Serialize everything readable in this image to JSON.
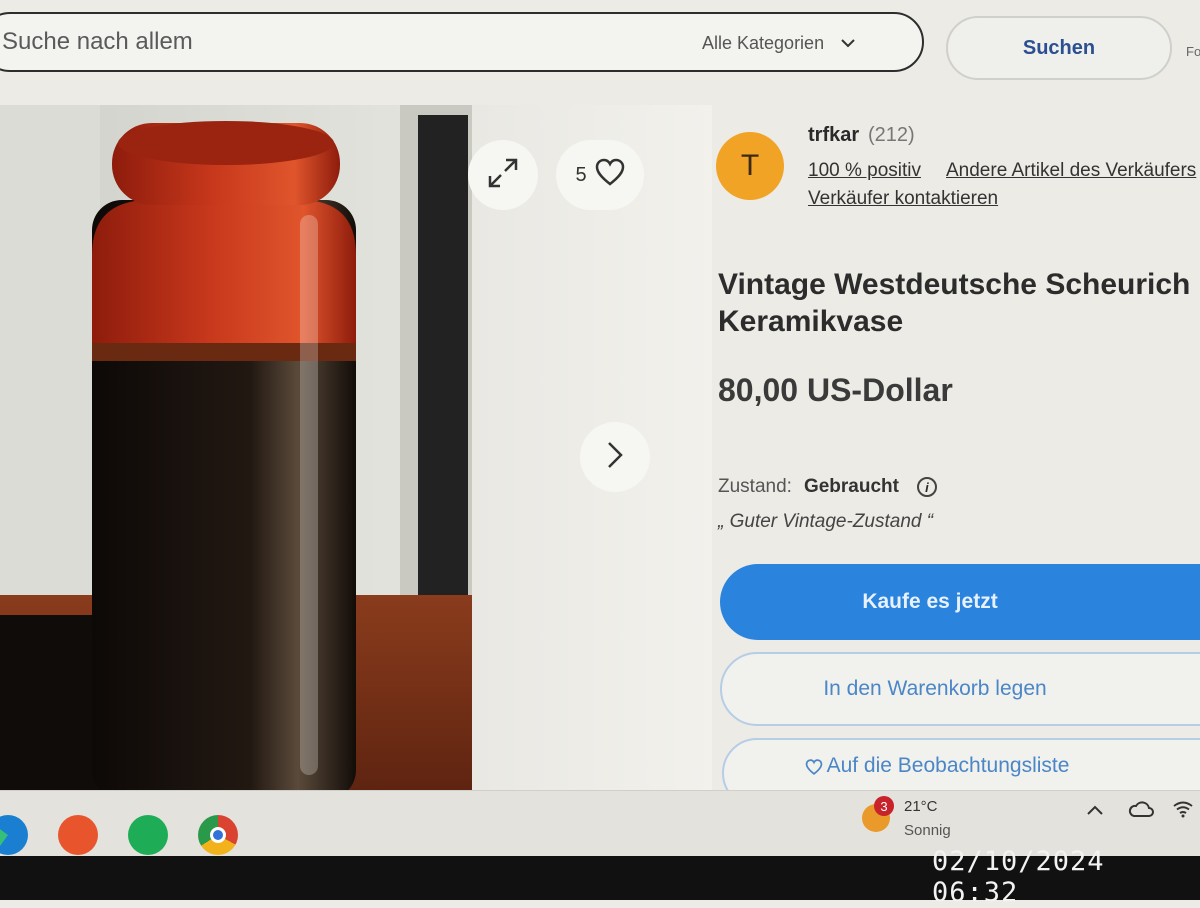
{
  "header": {
    "search_placeholder": "Suche nach allem",
    "category_label": "Alle Kategorien",
    "search_button": "Suchen",
    "advanced_label": "Fo"
  },
  "gallery": {
    "watch_count": "5"
  },
  "seller": {
    "avatar_letter": "T",
    "name": "trfkar",
    "rating_count": "(212)",
    "feedback": "100 % positiv",
    "other_items": "Andere Artikel des Verkäufers",
    "contact": "Verkäufer kontaktieren"
  },
  "item": {
    "title_line1": "Vintage Westdeutsche Scheurich",
    "title_line2": "Keramikvase",
    "price": "80,00 US-Dollar",
    "condition_label": "Zustand:",
    "condition_value": "Gebraucht",
    "condition_note": "„ Guter Vintage-Zustand “"
  },
  "actions": {
    "buy_now": "Kaufe es jetzt",
    "add_to_cart": "In den Warenkorb legen",
    "watchlist": "Auf die Beobachtungsliste"
  },
  "taskbar": {
    "weather_badge": "3",
    "temperature": "21°C",
    "weather": "Sonnig"
  },
  "photo_timestamp": "02/10/2024  06:32",
  "colors": {
    "accent": "#2a83dd",
    "seller_avatar": "#f1a326",
    "vase_top": "#c2341a",
    "vase_bottom": "#1a1410"
  }
}
